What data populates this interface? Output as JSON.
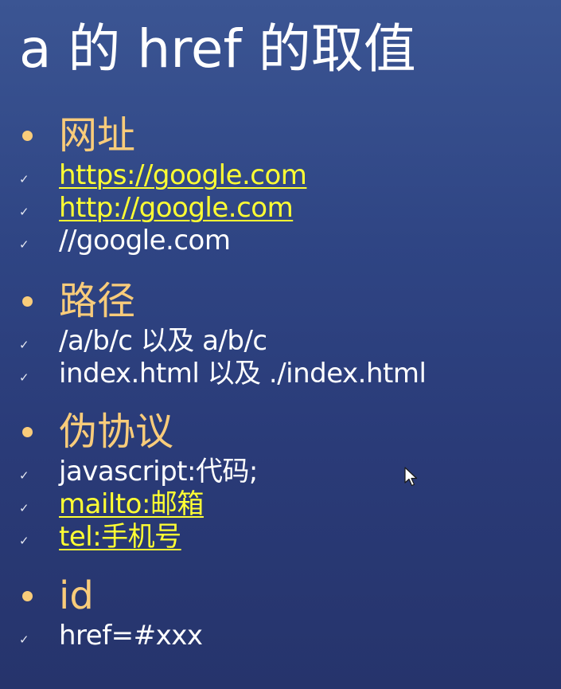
{
  "title": "a 的 href 的取值",
  "sections": [
    {
      "heading": "网址",
      "items": [
        {
          "text": "https://google.com",
          "link": true
        },
        {
          "text": "http://google.com",
          "link": true
        },
        {
          "text": "//google.com",
          "link": false
        }
      ]
    },
    {
      "heading": "路径",
      "items": [
        {
          "text": "/a/b/c 以及 a/b/c",
          "link": false
        },
        {
          "text": "index.html 以及 ./index.html",
          "link": false
        }
      ]
    },
    {
      "heading": "伪协议",
      "items": [
        {
          "text": "javascript:代码;",
          "link": false
        },
        {
          "text": "mailto:邮箱",
          "link": true
        },
        {
          "text": "tel:手机号",
          "link": true
        }
      ]
    },
    {
      "heading": "id",
      "items": [
        {
          "text": "href=#xxx",
          "link": false
        }
      ]
    }
  ],
  "check_mark": "✓",
  "colors": {
    "heading": "#f9cc7a",
    "link": "#ffff33",
    "text": "#ffffff"
  },
  "icons": {
    "bullet": "bullet-dot-icon",
    "check": "check-icon",
    "cursor": "mouse-pointer-icon"
  }
}
